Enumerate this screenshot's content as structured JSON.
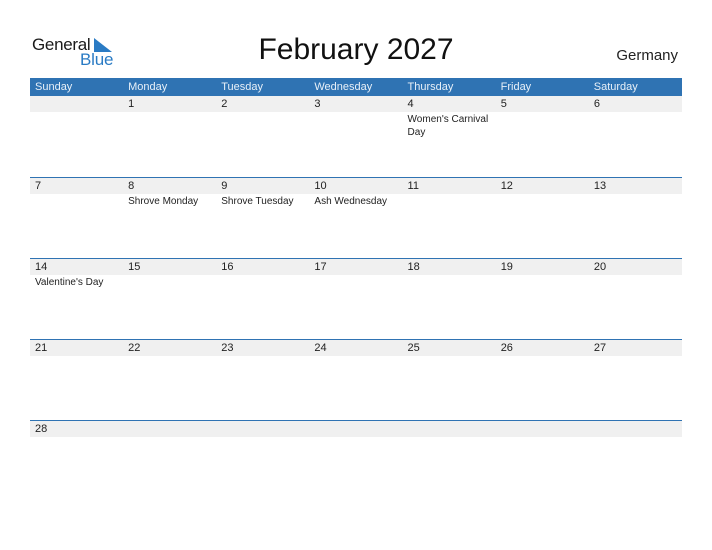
{
  "logo": {
    "part1": "General",
    "part2": "Blue"
  },
  "title": "February 2027",
  "country": "Germany",
  "colors": {
    "accent": "#2f73b3",
    "band": "#f0f0f0"
  },
  "weekdays": [
    "Sunday",
    "Monday",
    "Tuesday",
    "Wednesday",
    "Thursday",
    "Friday",
    "Saturday"
  ],
  "weeks": [
    [
      {
        "day": "",
        "event": ""
      },
      {
        "day": "1",
        "event": ""
      },
      {
        "day": "2",
        "event": ""
      },
      {
        "day": "3",
        "event": ""
      },
      {
        "day": "4",
        "event": "Women's Carnival Day"
      },
      {
        "day": "5",
        "event": ""
      },
      {
        "day": "6",
        "event": ""
      }
    ],
    [
      {
        "day": "7",
        "event": ""
      },
      {
        "day": "8",
        "event": "Shrove Monday"
      },
      {
        "day": "9",
        "event": "Shrove Tuesday"
      },
      {
        "day": "10",
        "event": "Ash Wednesday"
      },
      {
        "day": "11",
        "event": ""
      },
      {
        "day": "12",
        "event": ""
      },
      {
        "day": "13",
        "event": ""
      }
    ],
    [
      {
        "day": "14",
        "event": "Valentine's Day"
      },
      {
        "day": "15",
        "event": ""
      },
      {
        "day": "16",
        "event": ""
      },
      {
        "day": "17",
        "event": ""
      },
      {
        "day": "18",
        "event": ""
      },
      {
        "day": "19",
        "event": ""
      },
      {
        "day": "20",
        "event": ""
      }
    ],
    [
      {
        "day": "21",
        "event": ""
      },
      {
        "day": "22",
        "event": ""
      },
      {
        "day": "23",
        "event": ""
      },
      {
        "day": "24",
        "event": ""
      },
      {
        "day": "25",
        "event": ""
      },
      {
        "day": "26",
        "event": ""
      },
      {
        "day": "27",
        "event": ""
      }
    ],
    [
      {
        "day": "28",
        "event": ""
      },
      {
        "day": "",
        "event": ""
      },
      {
        "day": "",
        "event": ""
      },
      {
        "day": "",
        "event": ""
      },
      {
        "day": "",
        "event": ""
      },
      {
        "day": "",
        "event": ""
      },
      {
        "day": "",
        "event": ""
      }
    ]
  ]
}
